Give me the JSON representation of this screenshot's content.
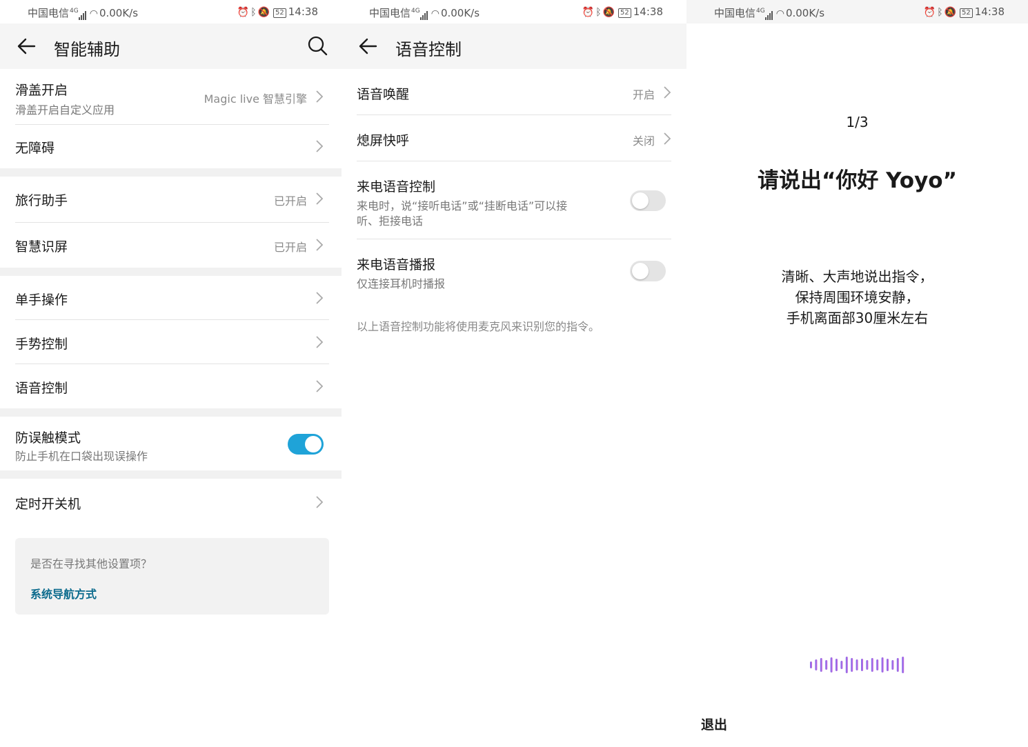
{
  "status_bar": {
    "carrier": "中国电信",
    "network": "4G",
    "speed": "0.00K/s",
    "battery": "52",
    "time": "14:38"
  },
  "screen1": {
    "title": "智能辅助",
    "rows": [
      {
        "title": "滑盖开启",
        "subtitle": "滑盖开启自定义应用",
        "value": "Magic live 智慧引擎"
      },
      {
        "title": "无障碍"
      },
      {
        "title": "旅行助手",
        "value": "已开启"
      },
      {
        "title": "智慧识屏",
        "value": "已开启"
      },
      {
        "title": "单手操作"
      },
      {
        "title": "手势控制"
      },
      {
        "title": "语音控制"
      },
      {
        "title": "防误触模式",
        "subtitle": "防止手机在口袋出现误操作",
        "toggle": "on"
      },
      {
        "title": "定时开关机"
      }
    ],
    "suggest_question": "是否在寻找其他设置项？",
    "suggest_link": "系统导航方式"
  },
  "screen2": {
    "title": "语音控制",
    "rows": [
      {
        "title": "语音唤醒",
        "value": "开启"
      },
      {
        "title": "熄屏快呼",
        "value": "关闭"
      },
      {
        "title": "来电语音控制",
        "subtitle_line1": "来电时，说“接听电话”或“挂断电话”可以接",
        "subtitle_line2": "听、拒接电话",
        "toggle": "off"
      },
      {
        "title": "来电语音播报",
        "subtitle": "仅连接耳机时播报",
        "toggle": "off"
      }
    ],
    "note": "以上语音控制功能将使用麦克风来识别您的指令。"
  },
  "screen3": {
    "step": "1/3",
    "prompt": "请说出“你好 Yoyo”",
    "instructions": [
      "清晰、大声地说出指令，",
      "保持周围环境安静，",
      "手机离面部30厘米左右"
    ],
    "exit": "退出"
  },
  "colors": {
    "accent": "#1fa3d8",
    "link": "#0c6b8d",
    "header_bg": "#f5f5f5",
    "wave_start": "#7b6cf0",
    "wave_end": "#c86ad8"
  }
}
